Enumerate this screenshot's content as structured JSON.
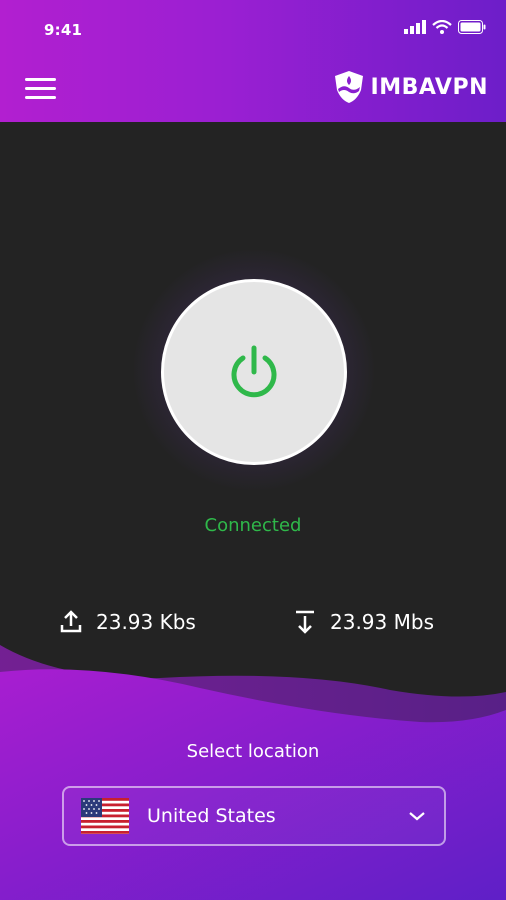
{
  "status_bar": {
    "time": "9:41",
    "icons": [
      "signal-icon",
      "wifi-icon",
      "battery-icon"
    ]
  },
  "header": {
    "menu_icon": "hamburger-menu-icon",
    "brand_icon": "shield-logo-icon",
    "brand_name": "IMBAVPN"
  },
  "connection": {
    "status": "Connected",
    "status_color": "#2fb84a",
    "power_icon": "power-icon"
  },
  "stats": {
    "upload": {
      "icon": "upload-icon",
      "value": "23.93 Kbs"
    },
    "download": {
      "icon": "download-icon",
      "value": "23.93 Mbs"
    }
  },
  "location": {
    "label": "Select location",
    "selected_country": "United States",
    "flag_icon": "us-flag-icon",
    "dropdown_icon": "chevron-down-icon"
  },
  "colors": {
    "accent_start": "#b21fd0",
    "accent_end": "#6d1ec9",
    "background": "#232323"
  }
}
